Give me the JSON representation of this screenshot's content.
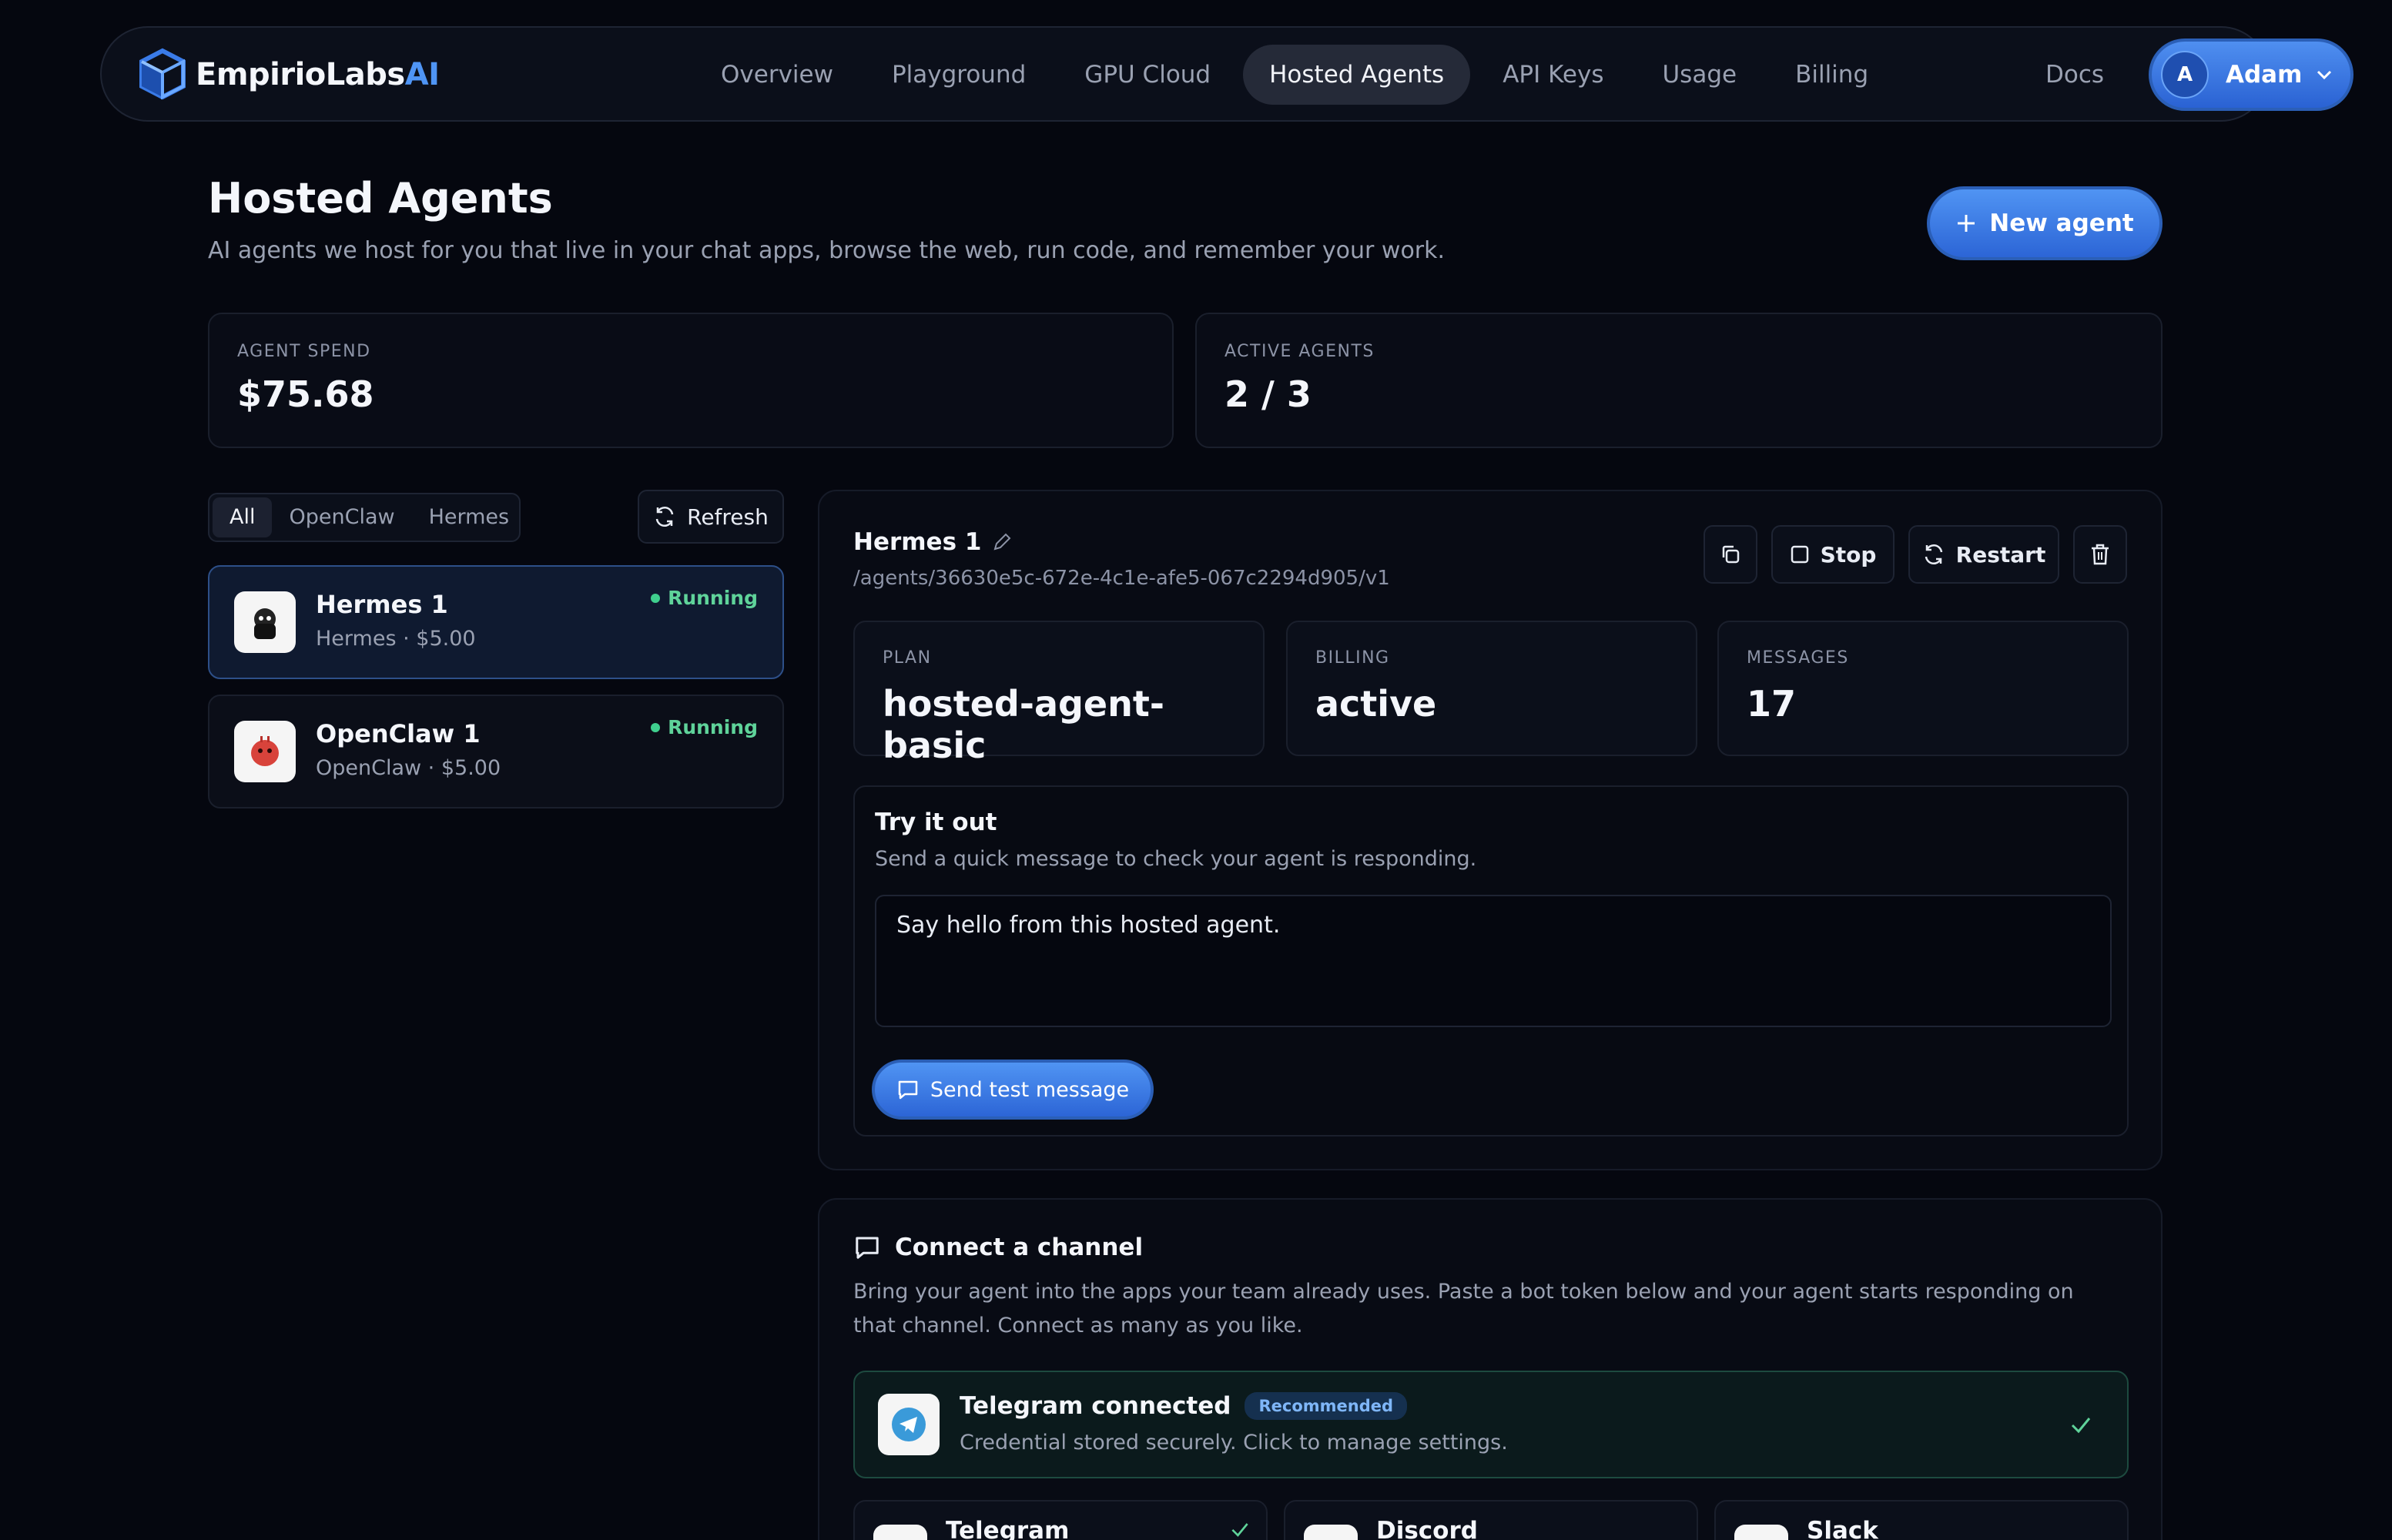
{
  "brand": {
    "name_main": "EmpirioLabs",
    "name_accent": "AI"
  },
  "nav": {
    "links": [
      "Overview",
      "Playground",
      "GPU Cloud",
      "Hosted Agents",
      "API Keys",
      "Usage",
      "Billing"
    ],
    "docs": "Docs",
    "user": {
      "initial": "A",
      "name": "Adam"
    }
  },
  "header": {
    "title": "Hosted Agents",
    "subtitle": "AI agents we host for you that live in your chat apps, browse the web, run code, and remember your work.",
    "new_agent_label": "New agent"
  },
  "stats": [
    {
      "label": "AGENT SPEND",
      "value": "$75.68"
    },
    {
      "label": "ACTIVE AGENTS",
      "value": "2 / 3"
    }
  ],
  "filters": {
    "tabs": [
      "All",
      "OpenClaw",
      "Hermes"
    ],
    "active": "All",
    "refresh_label": "Refresh"
  },
  "agents": [
    {
      "name": "Hermes 1",
      "meta": "Hermes · $5.00",
      "status": "Running"
    },
    {
      "name": "OpenClaw 1",
      "meta": "OpenClaw · $5.00",
      "status": "Running"
    }
  ],
  "detail": {
    "name": "Hermes 1",
    "path": "/agents/36630e5c-672e-4c1e-afe5-067c2294d905/v1",
    "stop_label": "Stop",
    "restart_label": "Restart",
    "kv": [
      {
        "label": "PLAN",
        "value": "hosted-agent-basic"
      },
      {
        "label": "BILLING",
        "value": "active"
      },
      {
        "label": "MESSAGES",
        "value": "17"
      }
    ],
    "try": {
      "title": "Try it out",
      "subtitle": "Send a quick message to check your agent is responding.",
      "input_value": "Say hello from this hosted agent.",
      "send_label": "Send test message"
    }
  },
  "channel": {
    "title": "Connect a channel",
    "desc": "Bring your agent into the apps your team already uses. Paste a bot token below and your agent starts responding on that channel. Connect as many as you like.",
    "connected": {
      "name": "Telegram connected",
      "badge": "Recommended",
      "sub": "Credential stored securely. Click to manage settings."
    },
    "options": [
      "Telegram",
      "Discord",
      "Slack"
    ]
  },
  "colors": {
    "accent": "#4f8ff0",
    "running": "#3fcf8e",
    "background": "#05070f"
  }
}
